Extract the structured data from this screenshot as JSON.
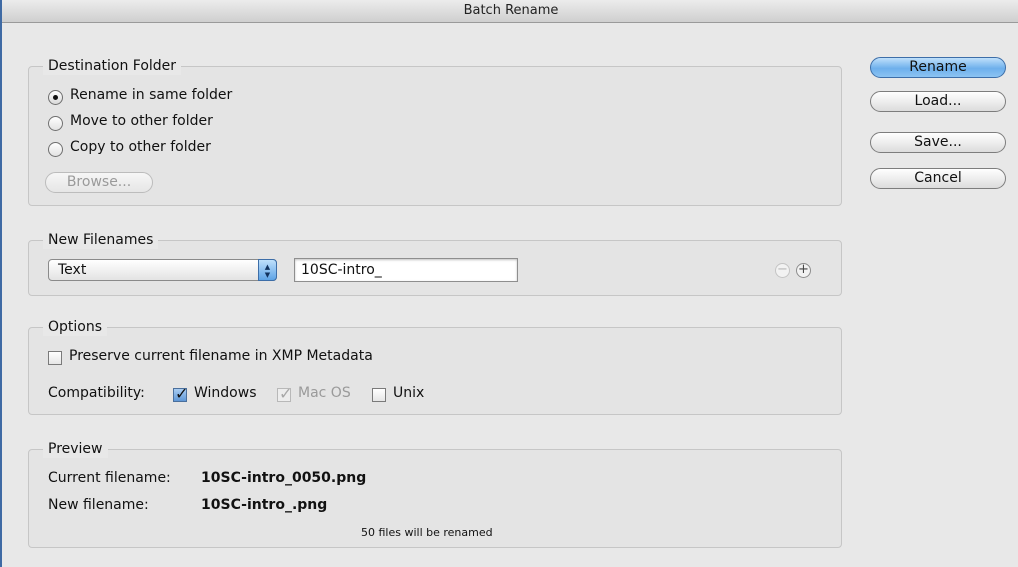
{
  "window": {
    "title": "Batch Rename"
  },
  "destination": {
    "group_title": "Destination Folder",
    "options": [
      {
        "label": "Rename in same folder",
        "selected": true
      },
      {
        "label": "Move to other folder",
        "selected": false
      },
      {
        "label": "Copy to other folder",
        "selected": false
      }
    ],
    "browse_label": "Browse..."
  },
  "new_filenames": {
    "group_title": "New Filenames",
    "type_select": "Text",
    "text_value": "10SC-intro_",
    "remove_icon": "minus-circle-icon",
    "add_icon": "plus-circle-icon"
  },
  "options": {
    "group_title": "Options",
    "preserve_label": "Preserve current filename in XMP Metadata",
    "preserve_checked": false,
    "compatibility_label": "Compatibility:",
    "windows_label": "Windows",
    "windows_checked": true,
    "macos_label": "Mac OS",
    "macos_checked": true,
    "unix_label": "Unix",
    "unix_checked": false
  },
  "preview": {
    "group_title": "Preview",
    "current_label": "Current filename:",
    "current_value": "10SC-intro_0050.png",
    "new_label": "New filename:",
    "new_value": "10SC-intro_.png",
    "summary": "50 files will be renamed"
  },
  "buttons": {
    "rename": "Rename",
    "load": "Load...",
    "save": "Save...",
    "cancel": "Cancel"
  },
  "colors": {
    "primary_button": "#6eb0ec",
    "window_edge": "#3f6aa4"
  }
}
